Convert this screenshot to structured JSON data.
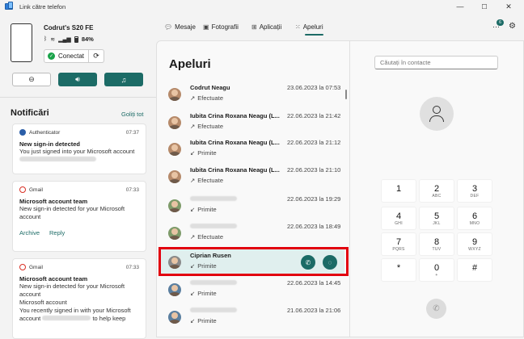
{
  "window": {
    "title": "Link către telefon",
    "min": "—",
    "max": "☐",
    "close": "✕"
  },
  "device": {
    "name": "Codrut's S20 FE",
    "battery": "84%",
    "status": "Conectat"
  },
  "notifications": {
    "title": "Notificări",
    "clear_all": "Goliți tot",
    "items": [
      {
        "app": "Authenticator",
        "time": "07:37",
        "title": "New sign-in detected",
        "body": "You just signed into your Microsoft account"
      },
      {
        "app": "Gmail",
        "time": "07:33",
        "title": "Microsoft account team",
        "body1": "New sign-in detected for your Microsoft",
        "body2": "account",
        "action1": "Archive",
        "action2": "Reply"
      },
      {
        "app": "Gmail",
        "time": "07:33",
        "title": "Microsoft account team",
        "body1": "New sign-in detected for your Microsoft",
        "body2": "account",
        "body3": "Microsoft account",
        "body4": "You recently signed in with your Microsoft",
        "body5": "account",
        "body6": "to help keep"
      }
    ]
  },
  "tabs": [
    {
      "label": "Mesaje",
      "icon": "chat-icon"
    },
    {
      "label": "Fotografii",
      "icon": "photo-icon"
    },
    {
      "label": "Aplicații",
      "icon": "apps-icon"
    },
    {
      "label": "Apeluri",
      "icon": "dialpad-icon"
    }
  ],
  "notif_badge": "6",
  "calls": {
    "title": "Apeluri",
    "items": [
      {
        "name": "Codrut Neagu",
        "type": "Efectuate",
        "date": "23.06.2023 la 07:53"
      },
      {
        "name": "Iubita Crina Roxana Neagu (L...",
        "type": "Efectuate",
        "date": "22.06.2023 la 21:42"
      },
      {
        "name": "Iubita Crina Roxana Neagu (L...",
        "type": "Primite",
        "date": "22.06.2023 la 21:12"
      },
      {
        "name": "Iubita Crina Roxana Neagu (L...",
        "type": "Efectuate",
        "date": "22.06.2023 la 21:10"
      },
      {
        "name": "",
        "type": "Primite",
        "date": "22.06.2023 la 19:29"
      },
      {
        "name": "",
        "type": "Efectuate",
        "date": "22.06.2023 la 18:49"
      },
      {
        "name": "Ciprian Rusen",
        "type": "Primite",
        "date": ""
      },
      {
        "name": "",
        "type": "Primite",
        "date": "22.06.2023 la 14:45"
      },
      {
        "name": "",
        "type": "Primite",
        "date": "21.06.2023 la 21:06"
      }
    ]
  },
  "search": {
    "placeholder": "Căutați în contacte"
  },
  "keypad": [
    {
      "d": "1",
      "l": ""
    },
    {
      "d": "2",
      "l": "ABC"
    },
    {
      "d": "3",
      "l": "DEF"
    },
    {
      "d": "4",
      "l": "GHI"
    },
    {
      "d": "5",
      "l": "JKL"
    },
    {
      "d": "6",
      "l": "MNO"
    },
    {
      "d": "7",
      "l": "PQRS"
    },
    {
      "d": "8",
      "l": "TUV"
    },
    {
      "d": "9",
      "l": "WXYZ"
    },
    {
      "d": "*",
      "l": ""
    },
    {
      "d": "0",
      "l": "+"
    },
    {
      "d": "#",
      "l": ""
    }
  ],
  "colors": {
    "accent": "#1c6b66",
    "highlight": "#e2000f",
    "connected": "#1aa34a"
  }
}
